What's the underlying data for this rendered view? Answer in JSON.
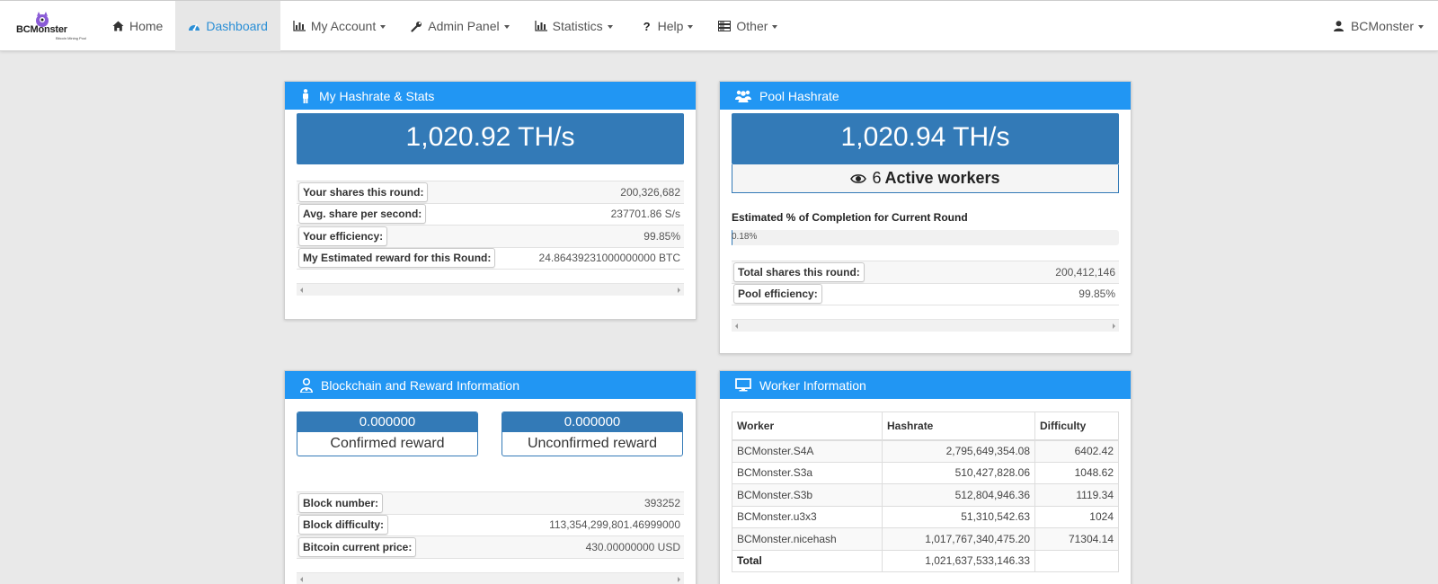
{
  "logo": {
    "brand": "BCMonster",
    "subtitle": "Bitcoin Mining Pool"
  },
  "nav": {
    "items": [
      {
        "label": "Home",
        "icon": "home-icon"
      },
      {
        "label": "Dashboard",
        "icon": "dashboard-icon",
        "active": true
      },
      {
        "label": "My Account",
        "icon": "bar-chart-icon"
      },
      {
        "label": "Admin Panel",
        "icon": "wrench-icon"
      },
      {
        "label": "Statistics",
        "icon": "bar-chart-icon"
      },
      {
        "label": "Help",
        "icon": "question-icon"
      },
      {
        "label": "Other",
        "icon": "server-icon"
      }
    ],
    "user": "BCMonster"
  },
  "my_stats": {
    "title": "My Hashrate & Stats",
    "hashrate": "1,020.92 TH/s",
    "rows": [
      {
        "label": "Your shares this round:",
        "value": "200,326,682"
      },
      {
        "label": "Avg. share per second:",
        "value": "237701.86 S/s"
      },
      {
        "label": "Your efficiency:",
        "value": "99.85%"
      },
      {
        "label": "My Estimated reward for this Round:",
        "value": "24.86439231000000000 BTC"
      }
    ]
  },
  "pool": {
    "title": "Pool Hashrate",
    "hashrate": "1,020.94 TH/s",
    "active_workers_count": "6",
    "active_workers_label": "Active workers",
    "completion_label": "Estimated % of Completion for Current Round",
    "completion_text": "0.18%",
    "completion_fraction": 0.0018,
    "rows": [
      {
        "label": "Total shares this round:",
        "value": "200,412,146"
      },
      {
        "label": "Pool efficiency:",
        "value": "99.85%"
      }
    ]
  },
  "blockchain": {
    "title": "Blockchain and Reward Information",
    "confirmed_value": "0.000000",
    "confirmed_label": "Confirmed reward",
    "unconfirmed_value": "0.000000",
    "unconfirmed_label": "Unconfirmed reward",
    "rows": [
      {
        "label": "Block number:",
        "value": "393252"
      },
      {
        "label": "Block difficulty:",
        "value": "113,354,299,801.46999000"
      },
      {
        "label": "Bitcoin current price:",
        "value": "430.00000000 USD"
      }
    ]
  },
  "workers": {
    "title": "Worker Information",
    "columns": [
      "Worker",
      "Hashrate",
      "Difficulty"
    ],
    "rows": [
      {
        "name": "BCMonster.S4A",
        "hashrate": "2,795,649,354.08",
        "difficulty": "6402.42"
      },
      {
        "name": "BCMonster.S3a",
        "hashrate": "510,427,828.06",
        "difficulty": "1048.62"
      },
      {
        "name": "BCMonster.S3b",
        "hashrate": "512,804,946.36",
        "difficulty": "1119.34"
      },
      {
        "name": "BCMonster.u3x3",
        "hashrate": "51,310,542.63",
        "difficulty": "1024"
      },
      {
        "name": "BCMonster.nicehash",
        "hashrate": "1,017,767,340,475.20",
        "difficulty": "71304.14"
      }
    ],
    "total_label": "Total",
    "total_hashrate": "1,021,637,533,146.33"
  },
  "colors": {
    "header_blue": "#2196f3",
    "stat_blue": "#337ab7",
    "nav_active": "#2b8fd6"
  }
}
